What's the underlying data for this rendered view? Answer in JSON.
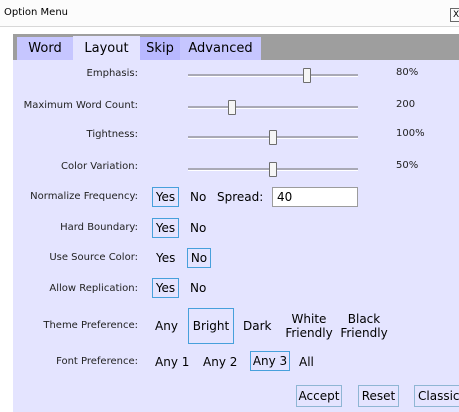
{
  "window": {
    "title": "Option Menu",
    "close_glyph": "X"
  },
  "tabs": [
    {
      "label": "Word"
    },
    {
      "label": "Layout"
    },
    {
      "label": "Skip"
    },
    {
      "label": "Advanced"
    }
  ],
  "sliders": [
    {
      "label": "Emphasis:",
      "value_text": "80%",
      "level": 0.7
    },
    {
      "label": "Maximum Word Count:",
      "value_text": "200",
      "level": 0.26
    },
    {
      "label": "Tightness:",
      "value_text": "100%",
      "level": 0.5
    },
    {
      "label": "Color Variation:",
      "value_text": "50%",
      "level": 0.5
    }
  ],
  "normalize": {
    "label": "Normalize Frequency:",
    "yes": "Yes",
    "no": "No",
    "spread_label": "Spread:",
    "spread_value": "40"
  },
  "hard_boundary": {
    "label": "Hard Boundary:",
    "yes": "Yes",
    "no": "No"
  },
  "source_color": {
    "label": "Use Source Color:",
    "yes": "Yes",
    "no": "No"
  },
  "replication": {
    "label": "Allow Replication:",
    "yes": "Yes",
    "no": "No"
  },
  "theme": {
    "label": "Theme Preference:",
    "any": "Any",
    "bright": "Bright",
    "dark": "Dark",
    "white_1": "White",
    "white_2": "Friendly",
    "black_1": "Black",
    "black_2": "Friendly"
  },
  "font": {
    "label": "Font Preference:",
    "any1": "Any 1",
    "any2": "Any 2",
    "any3": "Any 3",
    "all": "All"
  },
  "buttons": {
    "accept": "Accept",
    "reset": "Reset",
    "classic": "Classic"
  },
  "colors": {
    "tab_active": "#e4e4ff",
    "tab_inactive": "#c6c6ff",
    "selection_border": "#47a0dc",
    "panel": "#e4e4ff"
  }
}
